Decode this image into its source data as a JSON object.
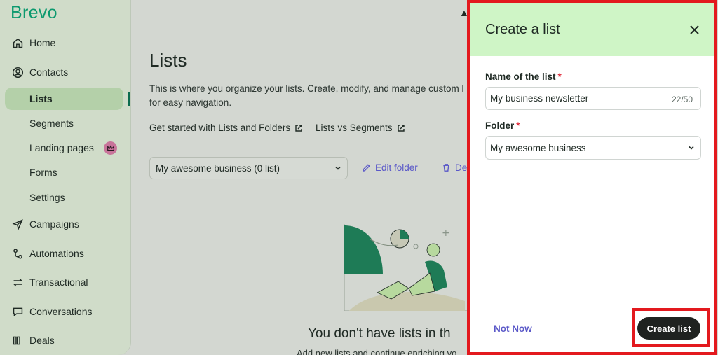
{
  "brand": {
    "logo": "Brevo",
    "color": "#0b996e"
  },
  "sidebar": {
    "items": [
      {
        "label": "Home",
        "icon": "home-icon"
      },
      {
        "label": "Contacts",
        "icon": "contacts-icon"
      },
      {
        "label": "Lists"
      },
      {
        "label": "Segments"
      },
      {
        "label": "Landing pages"
      },
      {
        "label": "Forms"
      },
      {
        "label": "Settings"
      },
      {
        "label": "Campaigns",
        "icon": "paper-plane-icon"
      },
      {
        "label": "Automations",
        "icon": "automation-icon"
      },
      {
        "label": "Transactional",
        "icon": "transactional-icon"
      },
      {
        "label": "Conversations",
        "icon": "chat-icon"
      },
      {
        "label": "Deals",
        "icon": "deals-icon"
      }
    ]
  },
  "main": {
    "title": "Lists",
    "description": "This is where you organize your lists. Create, modify, and manage custom l\nfor easy navigation.",
    "links": [
      "Get started with Lists and Folders",
      "Lists vs Segments"
    ],
    "folder_select": "My awesome business (0 list)",
    "edit_folder": "Edit folder",
    "delete_folder": "De",
    "empty_title": "You don't have lists in th",
    "empty_sub": "Add new lists and continue enriching yo"
  },
  "panel": {
    "title": "Create a list",
    "name_label": "Name of the list",
    "name_value": "My business newsletter",
    "name_counter": "22/50",
    "folder_label": "Folder",
    "required_mark": "*",
    "folder_value": "My awesome business",
    "not_now": "Not Now",
    "create": "Create list",
    "header_color": "#cff5c6",
    "highlight_color": "#e3191e"
  }
}
